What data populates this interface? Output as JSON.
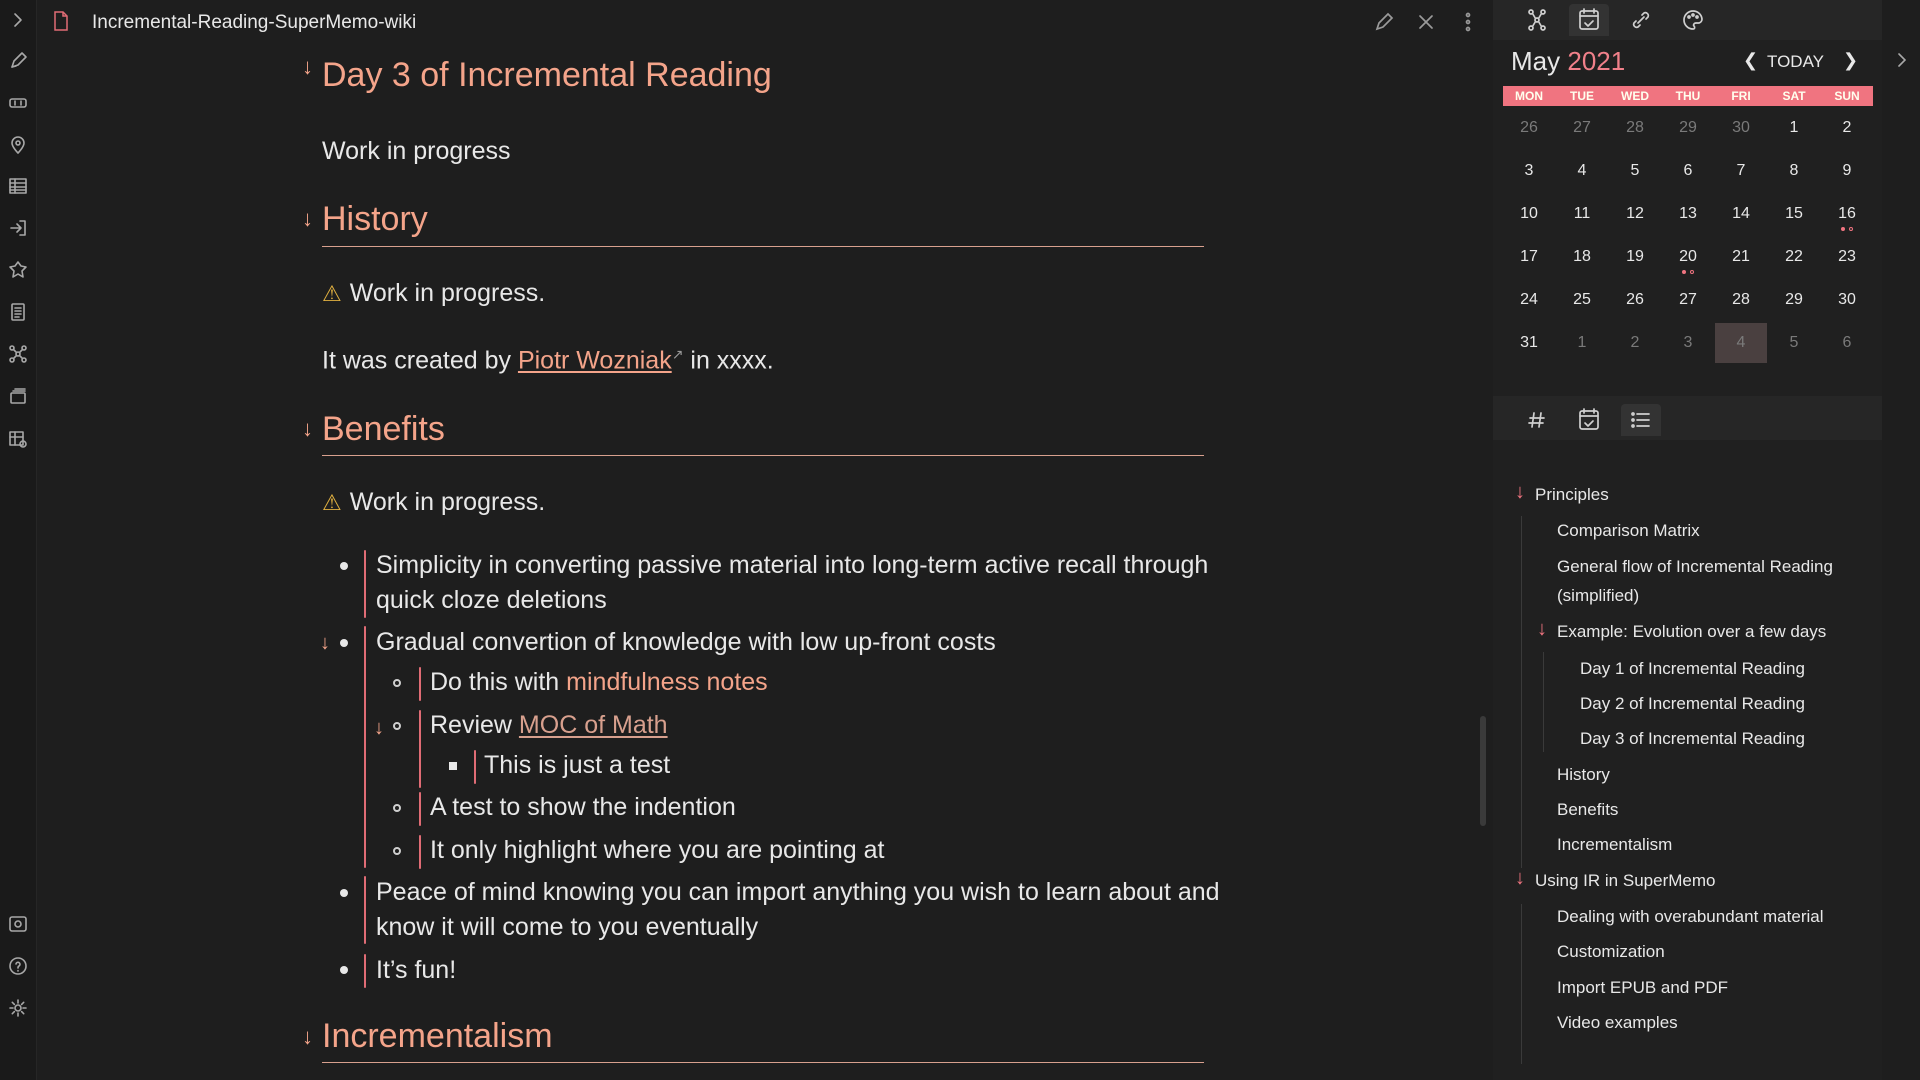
{
  "editor": {
    "file_title": "Incremental-Reading-SuperMemo-wiki",
    "icons": [
      "file-icon",
      "edit-icon",
      "close-icon",
      "more-options-icon"
    ]
  },
  "ribbon": {
    "icons": [
      "pencil-icon",
      "binoculars-icon",
      "map-pin-icon",
      "table-icon",
      "login-icon",
      "puzzle-icon",
      "document-list-icon",
      "graph-icon",
      "cards-icon",
      "table-settings-icon",
      "vault-icon",
      "help-icon",
      "settings-icon"
    ]
  },
  "doc": {
    "h_day3": "Day 3 of Incremental Reading",
    "p_wip1": "Work in progress",
    "h_history": "History",
    "p_wip2": "Work in progress.",
    "p_created_pre": "It was created by ",
    "p_created_link": "Piotr Wozniak",
    "p_created_post": " in xxxx.",
    "h_benefits": "Benefits",
    "p_wip3": "Work in progress.",
    "b1": "Simplicity in converting passive material into long-term active recall through quick cloze deletions",
    "b2": "Gradual convertion of knowledge with low up-front costs",
    "b2a_pre": "Do this with ",
    "b2a_hl": "mindfulness notes",
    "b2b_pre": "Review ",
    "b2b_link": "MOC of Math",
    "b2b1": "This is just a test",
    "b2c": "A test to show the indention",
    "b2d": "It only highlight where you are pointing at",
    "b3": "Peace of mind knowing you can import anything you wish to learn about and know it will come to you eventually",
    "b4": "It’s fun!",
    "h_incrementalism": "Incrementalism"
  },
  "calendar": {
    "month": "May",
    "year": "2021",
    "today_label": "TODAY",
    "dow": [
      "MON",
      "TUE",
      "WED",
      "THU",
      "FRI",
      "SAT",
      "SUN"
    ],
    "weeks": [
      [
        "26",
        "27",
        "28",
        "29",
        "30",
        "1",
        "2"
      ],
      [
        "3",
        "4",
        "5",
        "6",
        "7",
        "8",
        "9"
      ],
      [
        "10",
        "11",
        "12",
        "13",
        "14",
        "15",
        "16"
      ],
      [
        "17",
        "18",
        "19",
        "20",
        "21",
        "22",
        "23"
      ],
      [
        "24",
        "25",
        "26",
        "27",
        "28",
        "29",
        "30"
      ],
      [
        "31",
        "1",
        "2",
        "3",
        "4",
        "5",
        "6"
      ]
    ],
    "accent": "#f07480"
  },
  "sidebar_tabs": [
    "graph-view-icon",
    "calendar-icon",
    "link-icon",
    "palette-icon"
  ],
  "sidebar_tabs2": [
    "tag-icon",
    "calendar-icon",
    "outline-icon"
  ],
  "outline": {
    "items": [
      {
        "label": "Principles",
        "level": 0,
        "arrow": true
      },
      {
        "label": "Comparison Matrix",
        "level": 1
      },
      {
        "label": "General flow of Incremental Reading",
        "level": 1
      },
      {
        "label": "(simplified)",
        "level": 1
      },
      {
        "label": "Example: Evolution over a few days",
        "level": 1,
        "arrow": true
      },
      {
        "label": "Day 1 of Incremental Reading",
        "level": 2
      },
      {
        "label": "Day 2 of Incremental Reading",
        "level": 2
      },
      {
        "label": "Day 3 of Incremental Reading",
        "level": 2
      },
      {
        "label": "History",
        "level": 1
      },
      {
        "label": "Benefits",
        "level": 1
      },
      {
        "label": "Incrementalism",
        "level": 1
      },
      {
        "label": "Using IR in SuperMemo",
        "level": 0,
        "arrow": true
      },
      {
        "label": "Dealing with overabundant material",
        "level": 1
      },
      {
        "label": "Customization",
        "level": 1
      },
      {
        "label": "Import EPUB and PDF",
        "level": 1
      },
      {
        "label": "Video examples",
        "level": 1
      }
    ]
  }
}
